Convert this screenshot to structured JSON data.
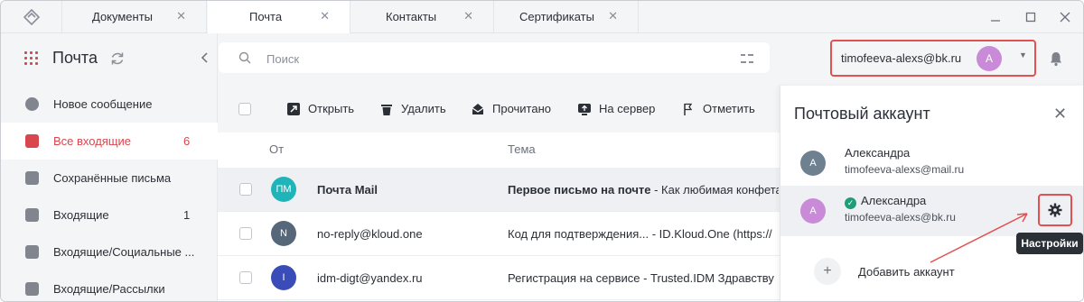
{
  "tabs": [
    {
      "label": "Документы"
    },
    {
      "label": "Почта"
    },
    {
      "label": "Контакты"
    },
    {
      "label": "Сертификаты"
    }
  ],
  "sidebar": {
    "title": "Почта",
    "items": [
      {
        "label": "Новое сообщение",
        "count": ""
      },
      {
        "label": "Все входящие",
        "count": "6"
      },
      {
        "label": "Сохранённые письма",
        "count": ""
      },
      {
        "label": "Входящие",
        "count": "1"
      },
      {
        "label": "Входящие/Социальные ...",
        "count": ""
      },
      {
        "label": "Входящие/Рассылки",
        "count": ""
      }
    ]
  },
  "search": {
    "placeholder": "Поиск"
  },
  "account": {
    "email": "timofeeva-alexs@bk.ru",
    "avatar_letter": "A"
  },
  "toolbar": {
    "open": "Открыть",
    "delete": "Удалить",
    "read": "Прочитано",
    "to_server": "На сервер",
    "mark": "Отметить"
  },
  "table": {
    "columns": {
      "from": "От",
      "subject": "Тема"
    },
    "rows": [
      {
        "avatar": "ПМ",
        "avatar_color": "#1fb5b8",
        "from": "Почта Mail",
        "subject_bold": "Первое письмо на почте",
        "subject_rest": " - Как любимая конфета",
        "bold": true
      },
      {
        "avatar": "N",
        "avatar_color": "#56677a",
        "from": "no-reply@kloud.one",
        "subject_bold": "",
        "subject_rest": "Код для подтверждения...  -  ID.Kloud.One (https://",
        "bold": false
      },
      {
        "avatar": "I",
        "avatar_color": "#3a4cb8",
        "from": "idm-digt@yandex.ru",
        "subject_bold": "",
        "subject_rest": "Регистрация на сервисе -  Trusted.IDM Здравству",
        "bold": false
      }
    ]
  },
  "panel": {
    "title": "Почтовый аккаунт",
    "accounts": [
      {
        "letter": "A",
        "color": "#6f8090",
        "name": "Александра",
        "email": "timofeeva-alexs@mail.ru"
      },
      {
        "letter": "A",
        "color": "#c98ad8",
        "name": "Александра",
        "email": "timofeeva-alexs@bk.ru"
      }
    ],
    "settings_tooltip": "Настройки",
    "add_account": "Добавить аккаунт"
  },
  "colors": {
    "accent": "#d9464e",
    "highlight_border": "#e2504f"
  }
}
